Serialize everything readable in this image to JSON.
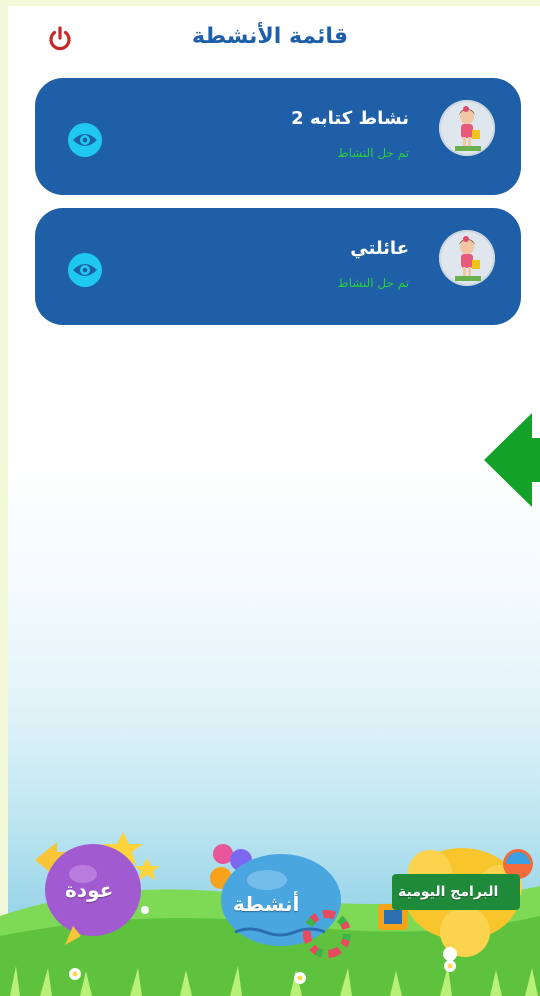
{
  "header": {
    "title": "قائمة الأنشطة",
    "power_icon": "power-icon"
  },
  "activities": [
    {
      "title": "نشاط كتابه 2",
      "status": "تم حل النشاط",
      "icon": "eye-icon"
    },
    {
      "title": "عائلتي",
      "status": "تم حل النشاط",
      "icon": "eye-icon"
    }
  ],
  "bottom_nav": {
    "back_label": "عودة",
    "activities_label": "أنشطة",
    "programs_label": "البرامج اليومية"
  },
  "colors": {
    "primary": "#1f5fa8",
    "status_green": "#2ecc40",
    "power_red": "#c62828",
    "eye_cyan": "#1ec8f0",
    "arrow_green": "#13a12a"
  }
}
